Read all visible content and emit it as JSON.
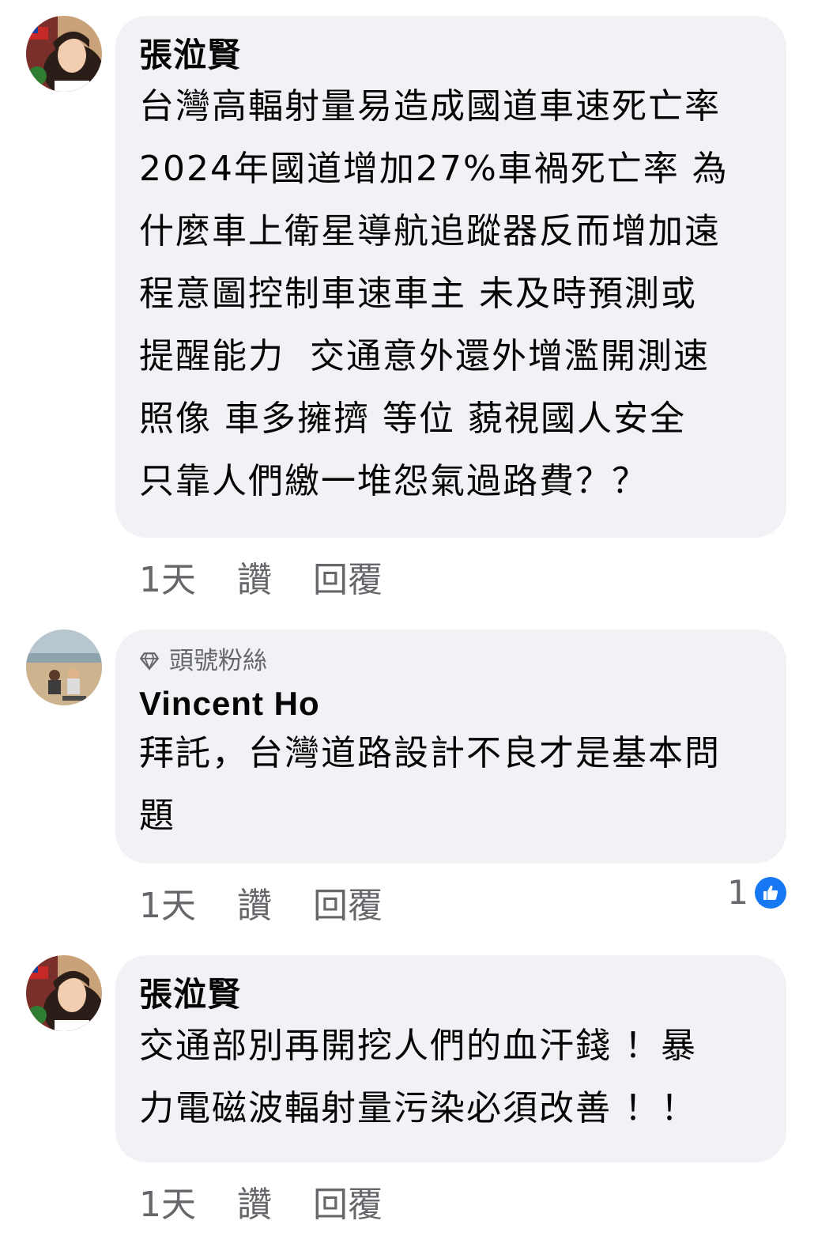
{
  "comments": [
    {
      "author": "張涖賢",
      "text": "台灣高輻射量易造成國道車速死亡率\n2024年國道增加27%車禍死亡率 為\n什麼車上衛星導航追蹤器反而增加遠\n程意圖控制車速車主 未及時預測或\n提醒能力  交通意外還外增濫開測速\n照像 車多擁擠 等位 藐視國人安全\n只靠人們繳一堆怨氣過路費？？",
      "time": "1天",
      "like_label": "讚",
      "reply_label": "回覆"
    },
    {
      "badge": "頭號粉絲",
      "author": "Vincent Ho",
      "text": "拜託，台灣道路設計不良才是基本問\n題",
      "time": "1天",
      "like_label": "讚",
      "reply_label": "回覆",
      "reaction_count": "1"
    },
    {
      "author": "張涖賢",
      "text": "交通部別再開挖人們的血汗錢 ！暴\n力電磁波輻射量污染必須改善 ！！",
      "time": "1天",
      "like_label": "讚",
      "reply_label": "回覆"
    }
  ],
  "colors": {
    "bubble": "#f0f2f5",
    "text": "#050505",
    "secondary": "#65676b",
    "like_blue": "#1877f2"
  },
  "icons": [
    "avatar",
    "diamond-icon",
    "like-reaction-icon"
  ]
}
